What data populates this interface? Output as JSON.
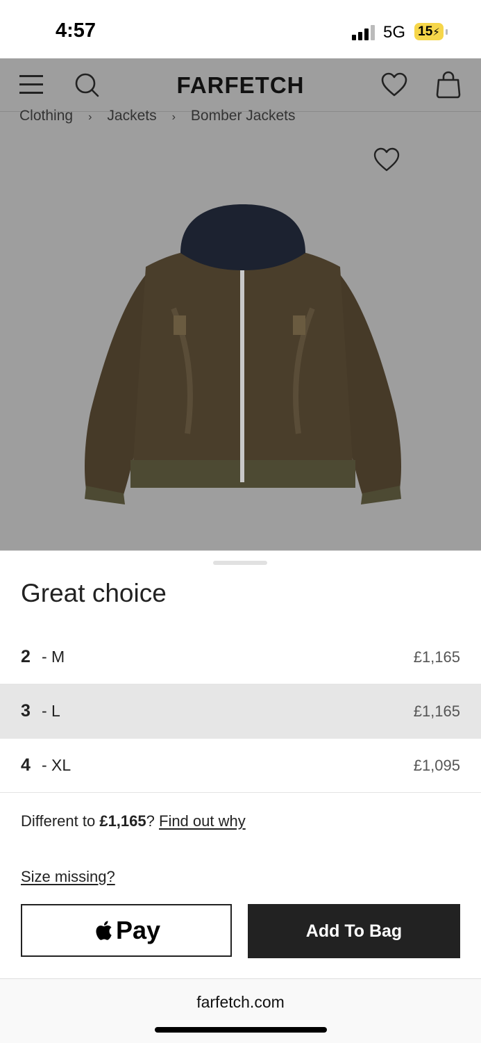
{
  "status_bar": {
    "time": "4:57",
    "network": "5G",
    "battery": "15"
  },
  "header": {
    "logo": "FARFETCH"
  },
  "breadcrumb": [
    "Clothing",
    "Jackets",
    "Bomber Jackets"
  ],
  "sheet": {
    "title": "Great choice",
    "sizes": [
      {
        "num": "2",
        "label": "- M",
        "price": "£1,165",
        "selected": false
      },
      {
        "num": "3",
        "label": "- L",
        "price": "£1,165",
        "selected": true
      },
      {
        "num": "4",
        "label": "- XL",
        "price": "£1,095",
        "selected": false
      }
    ],
    "price_note_prefix": "Different to ",
    "price_note_amount": "£1,165",
    "price_note_suffix": "?",
    "find_out_link": "Find out why",
    "size_missing_link": "Size missing?",
    "apple_pay_label": "Pay",
    "add_to_bag_label": "Add To Bag"
  },
  "browser": {
    "url": "farfetch.com"
  },
  "colors": {
    "accent": "#222222",
    "image_background": "#9e9e9e",
    "selected_row": "#e6e6e6",
    "battery": "#f6d64a"
  },
  "icons": [
    "signal-icon",
    "battery-icon",
    "menu-icon",
    "search-icon",
    "wishlist-heart-icon",
    "shopping-bag-icon",
    "apple-logo-icon"
  ]
}
